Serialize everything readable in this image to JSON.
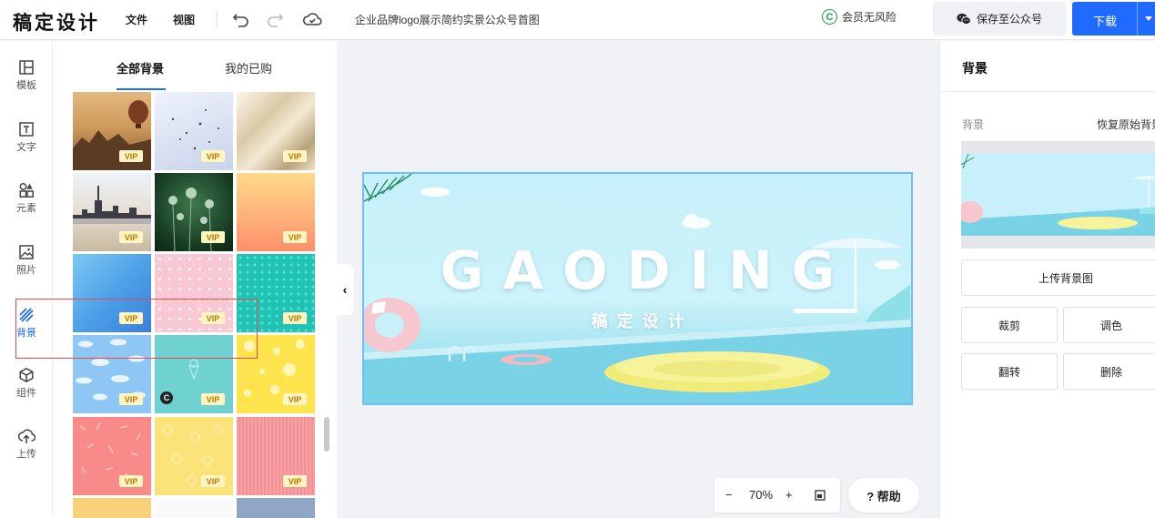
{
  "app": {
    "logo": "稿定设计"
  },
  "menu": {
    "file": "文件",
    "view": "视图"
  },
  "toolbar": {
    "undo_icon": "undo-icon",
    "redo_icon": "redo-icon",
    "cloud_icon": "cloud-check-icon"
  },
  "document": {
    "title": "企业品牌logo展示简约实景公众号首图"
  },
  "header": {
    "member_label": "会员无风险",
    "save_label": "保存至公众号",
    "download_label": "下载"
  },
  "sidebar": {
    "items": [
      {
        "label": "模板",
        "icon": "layout-icon"
      },
      {
        "label": "文字",
        "icon": "text-icon"
      },
      {
        "label": "元素",
        "icon": "shapes-icon"
      },
      {
        "label": "照片",
        "icon": "image-icon"
      },
      {
        "label": "背景",
        "icon": "stripes-icon",
        "active": true
      },
      {
        "label": "组件",
        "icon": "cube-icon"
      },
      {
        "label": "上传",
        "icon": "cloud-upload-icon"
      }
    ]
  },
  "panel": {
    "tabs": [
      {
        "label": "全部背景",
        "active": true
      },
      {
        "label": "我的已购"
      }
    ],
    "vip_label": "VIP",
    "c_label": "C",
    "thumbnails": [
      {
        "name": "desert-balloon",
        "vip": true
      },
      {
        "name": "birds-sky",
        "vip": true
      },
      {
        "name": "silk-gold",
        "vip": true
      },
      {
        "name": "city-skyline",
        "vip": true
      },
      {
        "name": "green-bokeh",
        "vip": true
      },
      {
        "name": "orange-gradient",
        "vip": true
      },
      {
        "name": "blue-gradient",
        "vip": true
      },
      {
        "name": "pink-dots",
        "vip": true
      },
      {
        "name": "teal-pattern",
        "vip": true
      },
      {
        "name": "blue-clouds",
        "vip": true
      },
      {
        "name": "teal-icecream",
        "vip": true,
        "copyright": true
      },
      {
        "name": "yellow-dots",
        "vip": true
      },
      {
        "name": "coral-confetti",
        "vip": true
      },
      {
        "name": "yellow-diamonds",
        "vip": true
      },
      {
        "name": "pink-texture",
        "vip": true
      }
    ]
  },
  "canvas": {
    "headline": "GAODING",
    "subheadline": "稿定设计",
    "zoom": "70%",
    "zoom_out": "−",
    "zoom_in": "+",
    "help_label": "? 帮助",
    "collapse": "‹"
  },
  "properties": {
    "title": "背景",
    "section_label": "背景",
    "restore_label": "恢复原始背景",
    "upload_label": "上传背景图",
    "crop_label": "裁剪",
    "color_label": "调色",
    "flip_label": "翻转",
    "delete_label": "删除"
  },
  "colors": {
    "accent": "#1f6bff",
    "member_green": "#1f9e4b",
    "selection_red": "#e5484d"
  }
}
